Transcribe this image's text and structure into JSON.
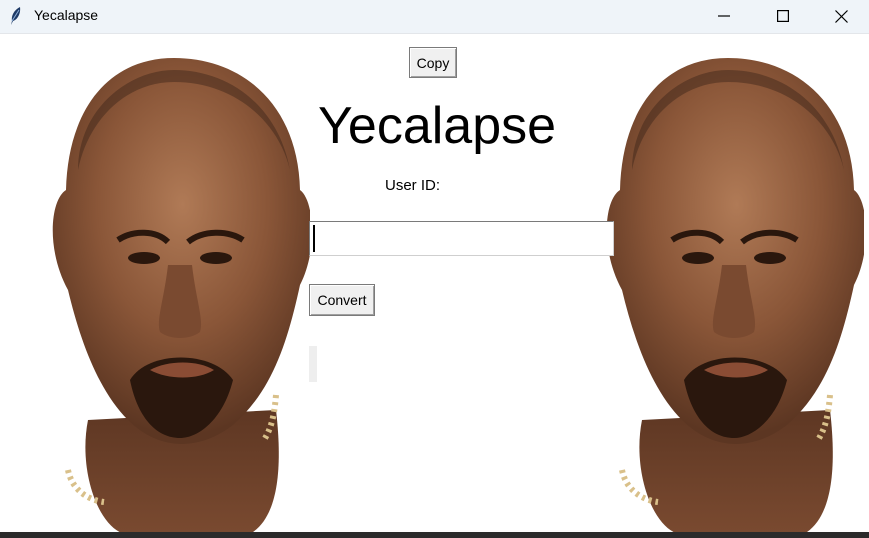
{
  "window": {
    "title": "Yecalapse",
    "icon": "feather-icon",
    "controls": [
      "minimize-icon",
      "maximize-icon",
      "close-icon"
    ]
  },
  "app": {
    "copy_button_label": "Copy",
    "heading": "Yecalapse",
    "user_id_label": "User ID:",
    "user_id_value": "",
    "convert_button_label": "Convert",
    "result_text": ""
  },
  "images": {
    "left_face": "portrait-photo",
    "right_face": "portrait-photo"
  }
}
